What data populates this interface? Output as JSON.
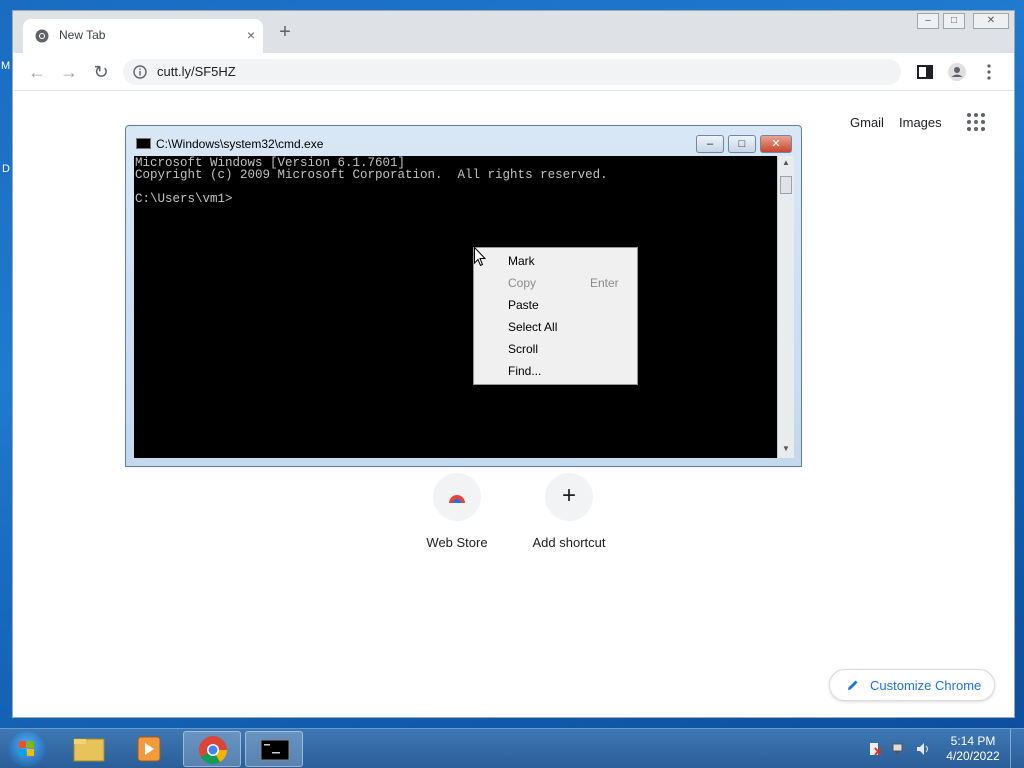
{
  "desktop": {
    "edge_m": "M",
    "edge_d": "D"
  },
  "browser": {
    "tab_title": "New Tab",
    "new_tab_label": "+",
    "close_tab_label": "×",
    "address": "cutt.ly/SF5HZ",
    "ntp": {
      "gmail": "Gmail",
      "images": "Images",
      "shortcuts": [
        {
          "label": "Web Store"
        },
        {
          "label": "Add shortcut",
          "symbol": "+"
        }
      ],
      "customize_label": "Customize Chrome"
    },
    "window_controls": {
      "minimize": "–",
      "maximize": "□",
      "close": "✕"
    }
  },
  "cmd": {
    "title": "C:\\Windows\\system32\\cmd.exe",
    "lines": [
      "Microsoft Windows [Version 6.1.7601]",
      "Copyright (c) 2009 Microsoft Corporation.  All rights reserved.",
      "",
      "C:\\Users\\vm1>"
    ],
    "controls": {
      "minimize": "–",
      "maximize": "□",
      "close": "✕"
    }
  },
  "context_menu": {
    "items": [
      {
        "label": "Mark",
        "enabled": true
      },
      {
        "label": "Copy",
        "shortcut": "Enter",
        "enabled": false
      },
      {
        "label": "Paste",
        "enabled": true
      },
      {
        "label": "Select All",
        "enabled": true
      },
      {
        "label": "Scroll",
        "enabled": true
      },
      {
        "label": "Find...",
        "enabled": true
      }
    ]
  },
  "taskbar": {
    "apps": [
      "folder",
      "media-player",
      "chrome",
      "cmd"
    ],
    "time": "5:14 PM",
    "date": "4/20/2022"
  },
  "colors": {
    "accent": "#1a73e8",
    "taskbar": "#2a5e98",
    "console_text": "#c0c0c0"
  }
}
